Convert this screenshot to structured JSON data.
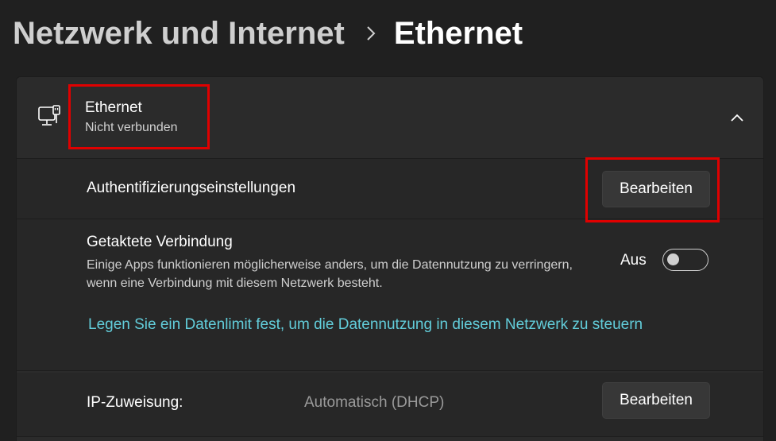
{
  "breadcrumb": {
    "parent": "Netzwerk und Internet",
    "separator_icon": "chevron-right-icon",
    "current": "Ethernet"
  },
  "ethernet_card": {
    "icon": "ethernet-icon",
    "title": "Ethernet",
    "status": "Nicht verbunden",
    "collapse_icon": "chevron-up-icon"
  },
  "auth_settings": {
    "label": "Authentifizierungseinstellungen",
    "button_label": "Bearbeiten"
  },
  "metered_connection": {
    "title": "Getaktete Verbindung",
    "description": "Einige Apps funktionieren möglicherweise anders, um die Datennutzung zu verringern, wenn eine Verbindung mit diesem Netzwerk besteht.",
    "toggle_state_label": "Aus",
    "toggle_on": false,
    "data_limit_link": "Legen Sie ein Datenlimit fest, um die Datennutzung in diesem Netzwerk zu steuern"
  },
  "ip_assignment": {
    "label": "IP-Zuweisung:",
    "value": "Automatisch (DHCP)",
    "button_label": "Bearbeiten"
  },
  "colors": {
    "background": "#202020",
    "card": "#2b2b2b",
    "link": "#62cdda",
    "highlight": "#e00000"
  }
}
